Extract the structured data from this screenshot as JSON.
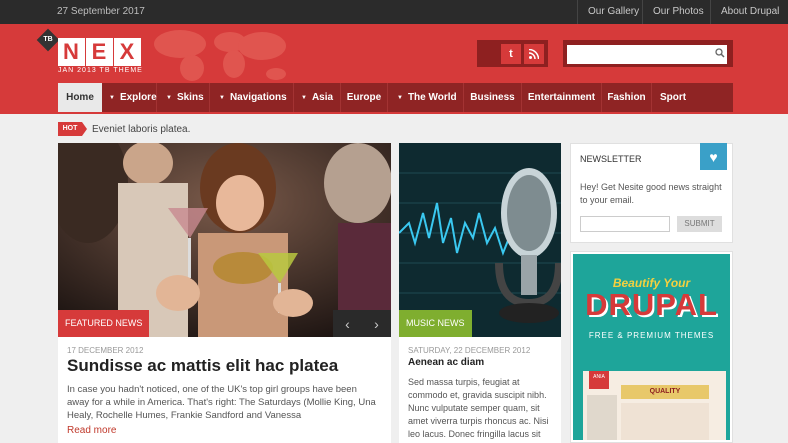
{
  "topbar": {
    "date": "27 September 2017",
    "links": [
      "Our Gallery",
      "Our Photos",
      "About Drupal"
    ]
  },
  "header": {
    "badge": "TB",
    "logo_letters": [
      "N",
      "E",
      "X"
    ],
    "tagline": "JAN 2013 TB THEME",
    "social": [
      "twitter-icon",
      "rss-icon"
    ],
    "search": {
      "placeholder": ""
    }
  },
  "nav": {
    "items": [
      {
        "label": "Home",
        "dropdown": false,
        "active": true
      },
      {
        "label": "Explore",
        "dropdown": true
      },
      {
        "label": "Skins",
        "dropdown": true
      },
      {
        "label": "Navigations",
        "dropdown": true
      },
      {
        "label": "Asia",
        "dropdown": true
      },
      {
        "label": "Europe",
        "dropdown": false
      },
      {
        "label": "The World",
        "dropdown": true
      },
      {
        "label": "Business",
        "dropdown": false
      },
      {
        "label": "Entertainment",
        "dropdown": false
      },
      {
        "label": "Fashion",
        "dropdown": false
      },
      {
        "label": "Sport",
        "dropdown": false
      }
    ]
  },
  "hot": {
    "badge": "HOT",
    "text": "Eveniet laboris platea."
  },
  "articles": {
    "featured": {
      "tag": "FEATURED NEWS",
      "date": "17 DECEMBER 2012",
      "title": "Sundisse ac mattis elit hac platea",
      "excerpt": "In case you hadn't noticed, one of the UK's top girl groups have been away for a while in America. That's right: The Saturdays (Mollie King, Una Healy, Rochelle Humes, Frankie Sandford and Vanessa",
      "read_more": "Read more",
      "prev": "‹",
      "next": "›"
    },
    "music": {
      "tag": "MUSIC NEWS",
      "date": "SATURDAY, 22 DECEMBER 2012",
      "title": "Aenean ac diam",
      "excerpt": "Sed massa turpis, feugiat at commodo et, gravida suscipit nibh. Nunc vulputate semper quam, sit amet viverra turpis rhoncus ac. Nisi leo lacus. Donec fringilla lacus sit amet"
    }
  },
  "newsletter": {
    "title": "NEWSLETTER",
    "text": "Hey! Get Nesite good news straight to your email.",
    "input_placeholder": "",
    "button": "SUBMIT"
  },
  "ad": {
    "beautify": "Beautify Your",
    "drupal": "DRUPAL",
    "subtitle": "FREE & PREMIUM THEMES",
    "badge": "ANIA",
    "quality": "QUALITY"
  },
  "colors": {
    "brand": "#d63a3a",
    "nav": "#8f2424",
    "topbar": "#2b2b2b",
    "music": "#7fae2f",
    "teal": "#1ea59a"
  }
}
